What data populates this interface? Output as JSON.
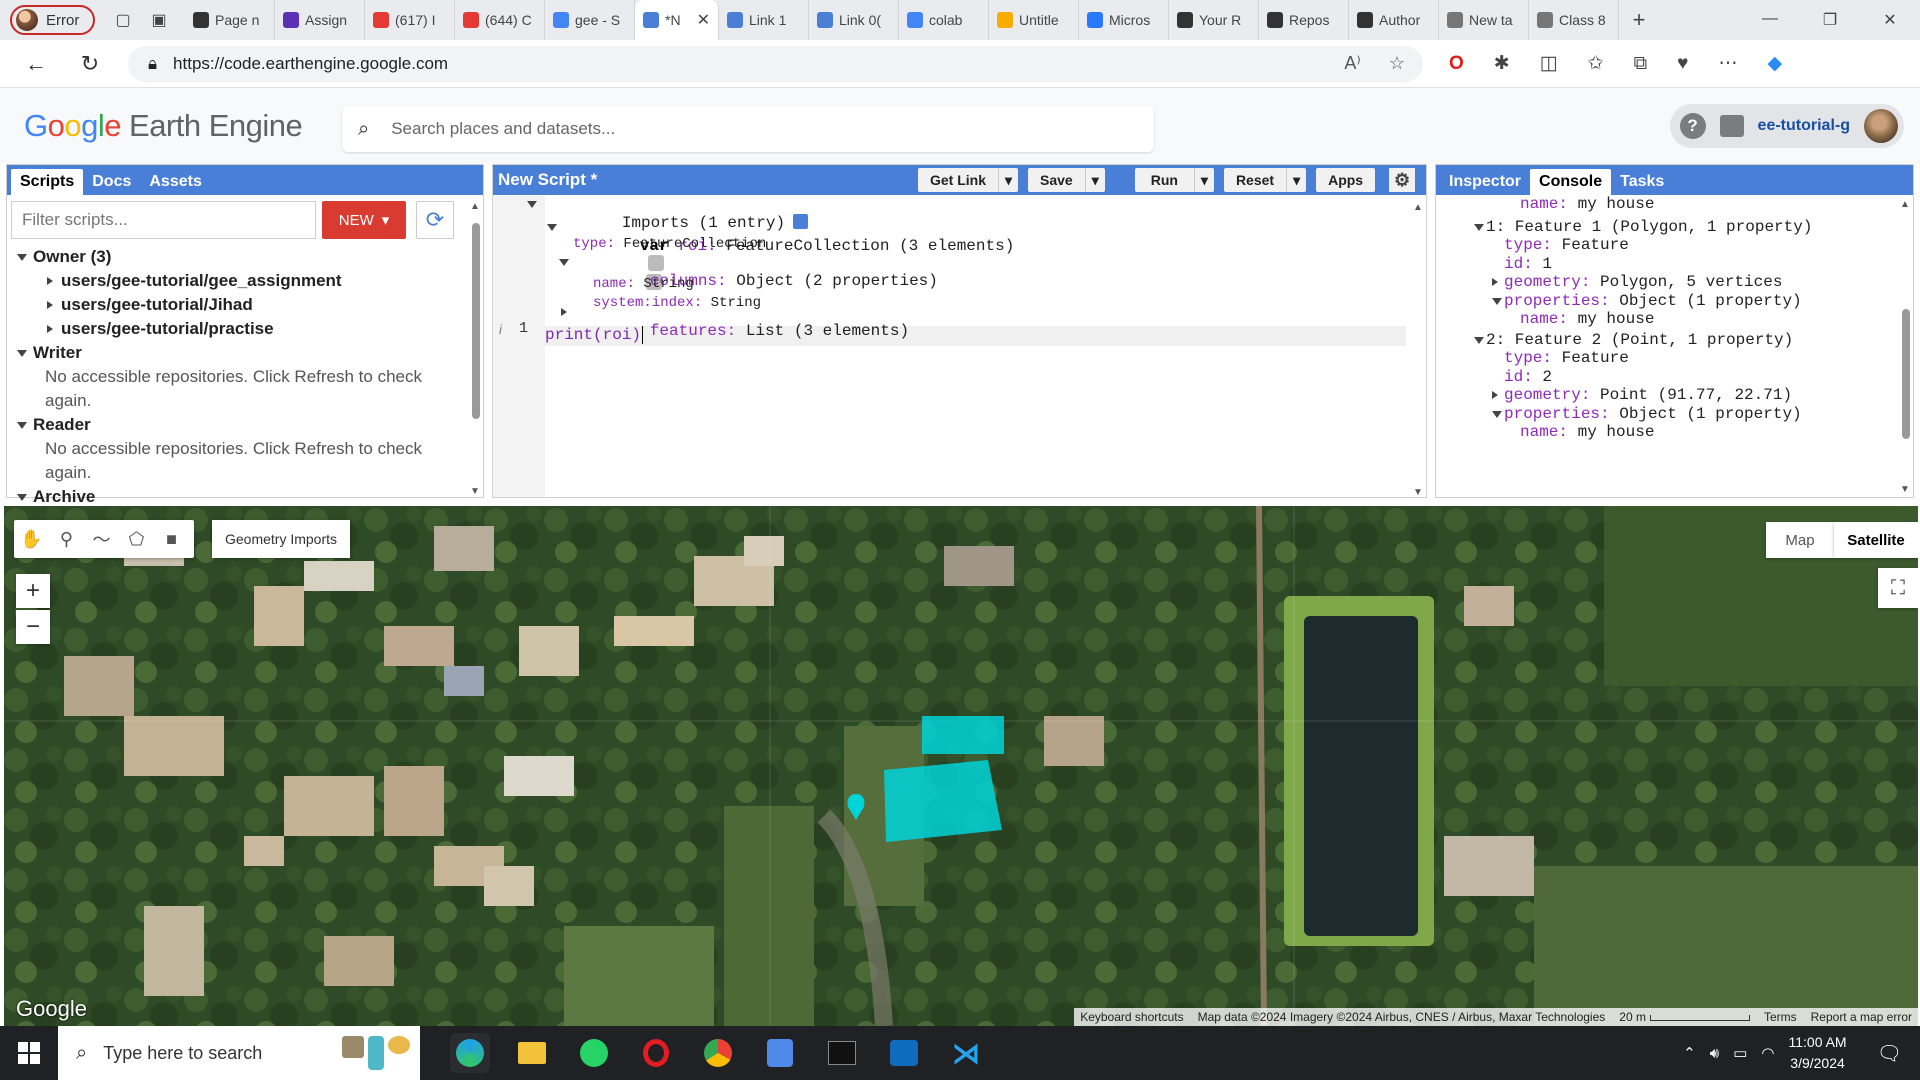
{
  "browser": {
    "error_tab": "Error",
    "tabs": [
      {
        "label": "Page n",
        "color": "#333333"
      },
      {
        "label": "Assign",
        "color": "#5b2fb6"
      },
      {
        "label": "(617) I",
        "color": "#e53935"
      },
      {
        "label": "(644) C",
        "color": "#e53935"
      },
      {
        "label": "gee - S",
        "color": "#4285f4"
      },
      {
        "label": "*N",
        "color": "#4a7fd8",
        "active": true
      },
      {
        "label": "Link 1",
        "color": "#4a7fd8"
      },
      {
        "label": "Link 0(",
        "color": "#4a7fd8"
      },
      {
        "label": "colab",
        "color": "#4285f4"
      },
      {
        "label": "Untitle",
        "color": "#f9ab00"
      },
      {
        "label": "Micros",
        "color": "#2979ff"
      },
      {
        "label": "Your R",
        "color": "#333333"
      },
      {
        "label": "Repos",
        "color": "#333333"
      },
      {
        "label": "Author",
        "color": "#333333"
      },
      {
        "label": "New ta",
        "color": "#777777"
      },
      {
        "label": "Class 8",
        "color": "#777777"
      }
    ],
    "url": "https://code.earthengine.google.com"
  },
  "header": {
    "logo_google": "Google",
    "logo_product": "Earth Engine",
    "search_placeholder": "Search places and datasets...",
    "user": "ee-tutorial-g"
  },
  "left_panel": {
    "tabs": [
      "Scripts",
      "Docs",
      "Assets"
    ],
    "filter_placeholder": "Filter scripts...",
    "new_label": "NEW",
    "owner": "Owner (3)",
    "repos": [
      "users/gee-tutorial/gee_assignment",
      "users/gee-tutorial/Jihad",
      "users/gee-tutorial/practise"
    ],
    "writer": "Writer",
    "writer_note": "No accessible repositories. Click Refresh to check again.",
    "reader": "Reader",
    "reader_note": "No accessible repositories. Click Refresh to check again.",
    "archive": "Archive"
  },
  "editor": {
    "title": "New Script *",
    "buttons": [
      "Get Link",
      "Save",
      "Run",
      "Reset",
      "Apps"
    ],
    "imports": "Imports (1 entry)",
    "var_line_kw": "var",
    "var_name": "roi",
    "var_type": "FeatureCollection (3 elements)",
    "type_key": "type",
    "type_val": "FeatureCollection",
    "columns_key": "columns",
    "columns_val": "Object (2 properties)",
    "col_name_key": "name",
    "col_name_val": "String",
    "col_idx_key": "system:index",
    "col_idx_val": "String",
    "features_key": "features",
    "features_val": "List (3 elements)",
    "line_number": "1",
    "code": "print(roi)"
  },
  "right_panel": {
    "tabs": [
      "Inspector",
      "Console",
      "Tasks"
    ],
    "lines": [
      {
        "indent": 0,
        "arrow": "",
        "key": "name",
        "val": "my house"
      },
      {
        "indent": -1,
        "arrow": "down",
        "key": "",
        "val": "1: Feature 1 (Polygon, 1 property)"
      },
      {
        "indent": 1,
        "arrow": "",
        "key": "type",
        "val": "Feature"
      },
      {
        "indent": 1,
        "arrow": "",
        "key": "id",
        "val": "1"
      },
      {
        "indent": 1,
        "arrow": "right",
        "key": "geometry",
        "val": "Polygon, 5 vertices"
      },
      {
        "indent": 1,
        "arrow": "down",
        "key": "properties",
        "val": "Object (1 property)"
      },
      {
        "indent": 2,
        "arrow": "",
        "key": "name",
        "val": "my house"
      },
      {
        "indent": -1,
        "arrow": "down",
        "key": "",
        "val": "2: Feature 2 (Point, 1 property)"
      },
      {
        "indent": 1,
        "arrow": "",
        "key": "type",
        "val": "Feature"
      },
      {
        "indent": 1,
        "arrow": "",
        "key": "id",
        "val": "2"
      },
      {
        "indent": 1,
        "arrow": "right",
        "key": "geometry",
        "val": "Point (91.77, 22.71)"
      },
      {
        "indent": 1,
        "arrow": "down",
        "key": "properties",
        "val": "Object (1 property)"
      },
      {
        "indent": 2,
        "arrow": "",
        "key": "name",
        "val": "my house"
      }
    ]
  },
  "map": {
    "geometry_imports": "Geometry Imports",
    "map_btn": "Map",
    "satellite_btn": "Satellite",
    "zoom_in": "+",
    "zoom_out": "−",
    "google_mark": "Google",
    "attribution": [
      "Keyboard shortcuts",
      "Map data ©2024 Imagery ©2024 Airbus, CNES / Airbus, Maxar Technologies",
      "20 m",
      "Terms",
      "Report a map error"
    ],
    "feature_color": "#00d4d8"
  },
  "taskbar": {
    "search_placeholder": "Type here to search",
    "time": "11:00 AM",
    "date": "3/9/2024"
  }
}
